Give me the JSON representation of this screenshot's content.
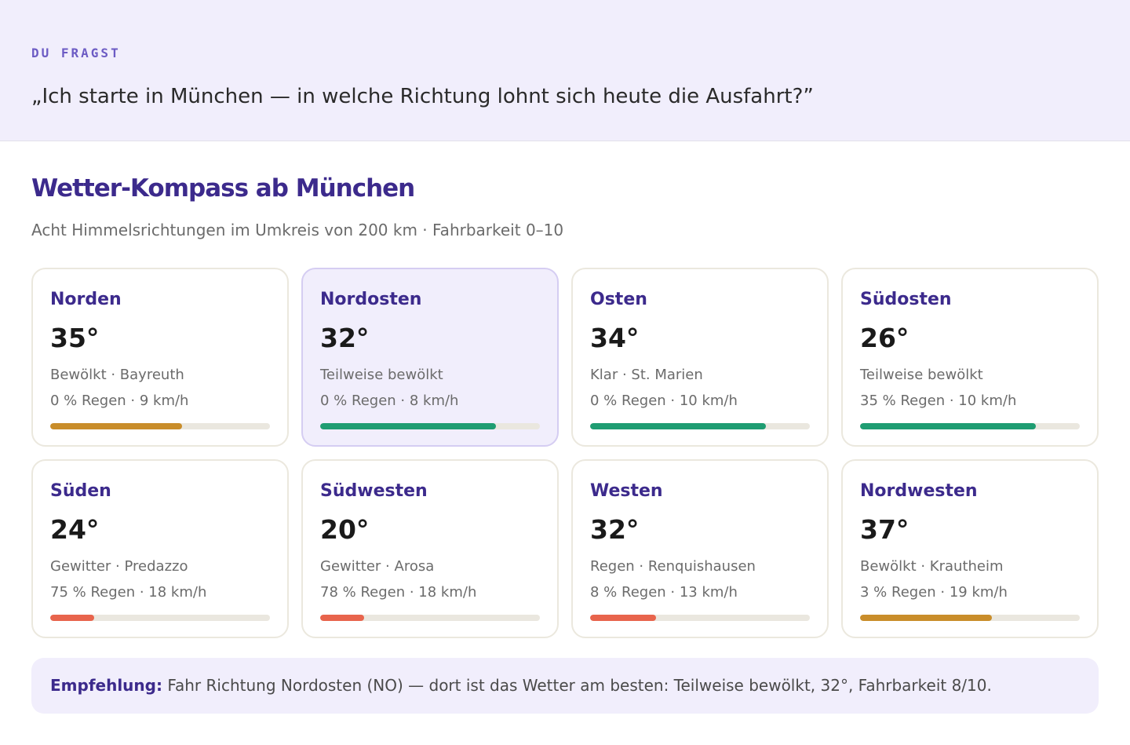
{
  "question": {
    "label": "DU FRAGST",
    "text": "„Ich starte in München — in welche Richtung lohnt sich heute die Ausfahrt?”"
  },
  "compass": {
    "title": "Wetter-Kompass ab München",
    "subtitle": "Acht Himmelsrichtungen im Umkreis von 200 km · Fahrbarkeit 0–10",
    "directions": [
      {
        "name": "Norden",
        "temp": "35°",
        "condition": "Bewölkt · Bayreuth",
        "rain_wind": "0 % Regen · 9 km/h",
        "rideability": 6,
        "bar_color": "#c98d2a",
        "highlight": false
      },
      {
        "name": "Nordosten",
        "temp": "32°",
        "condition": "Teilweise bewölkt",
        "rain_wind": "0 % Regen · 8 km/h",
        "rideability": 8,
        "bar_color": "#1f9d72",
        "highlight": true
      },
      {
        "name": "Osten",
        "temp": "34°",
        "condition": "Klar · St. Marien",
        "rain_wind": "0 % Regen · 10 km/h",
        "rideability": 8,
        "bar_color": "#1f9d72",
        "highlight": false
      },
      {
        "name": "Südosten",
        "temp": "26°",
        "condition": "Teilweise bewölkt",
        "rain_wind": "35 % Regen · 10 km/h",
        "rideability": 8,
        "bar_color": "#1f9d72",
        "highlight": false
      },
      {
        "name": "Süden",
        "temp": "24°",
        "condition": "Gewitter · Predazzo",
        "rain_wind": "75 % Regen · 18 km/h",
        "rideability": 2,
        "bar_color": "#e8644c",
        "highlight": false
      },
      {
        "name": "Südwesten",
        "temp": "20°",
        "condition": "Gewitter · Arosa",
        "rain_wind": "78 % Regen · 18 km/h",
        "rideability": 2,
        "bar_color": "#e8644c",
        "highlight": false
      },
      {
        "name": "Westen",
        "temp": "32°",
        "condition": "Regen · Renquishausen",
        "rain_wind": "8 % Regen · 13 km/h",
        "rideability": 3,
        "bar_color": "#e8644c",
        "highlight": false
      },
      {
        "name": "Nordwesten",
        "temp": "37°",
        "condition": "Bewölkt · Krautheim",
        "rain_wind": "3 % Regen · 19 km/h",
        "rideability": 6,
        "bar_color": "#c98d2a",
        "highlight": false
      }
    ]
  },
  "recommendation": {
    "label": "Empfehlung:",
    "text": "Fahr Richtung Nordosten (NO) — dort ist das Wetter am besten: Teilweise bewölkt, 32°, Fahrbarkeit 8/10."
  }
}
